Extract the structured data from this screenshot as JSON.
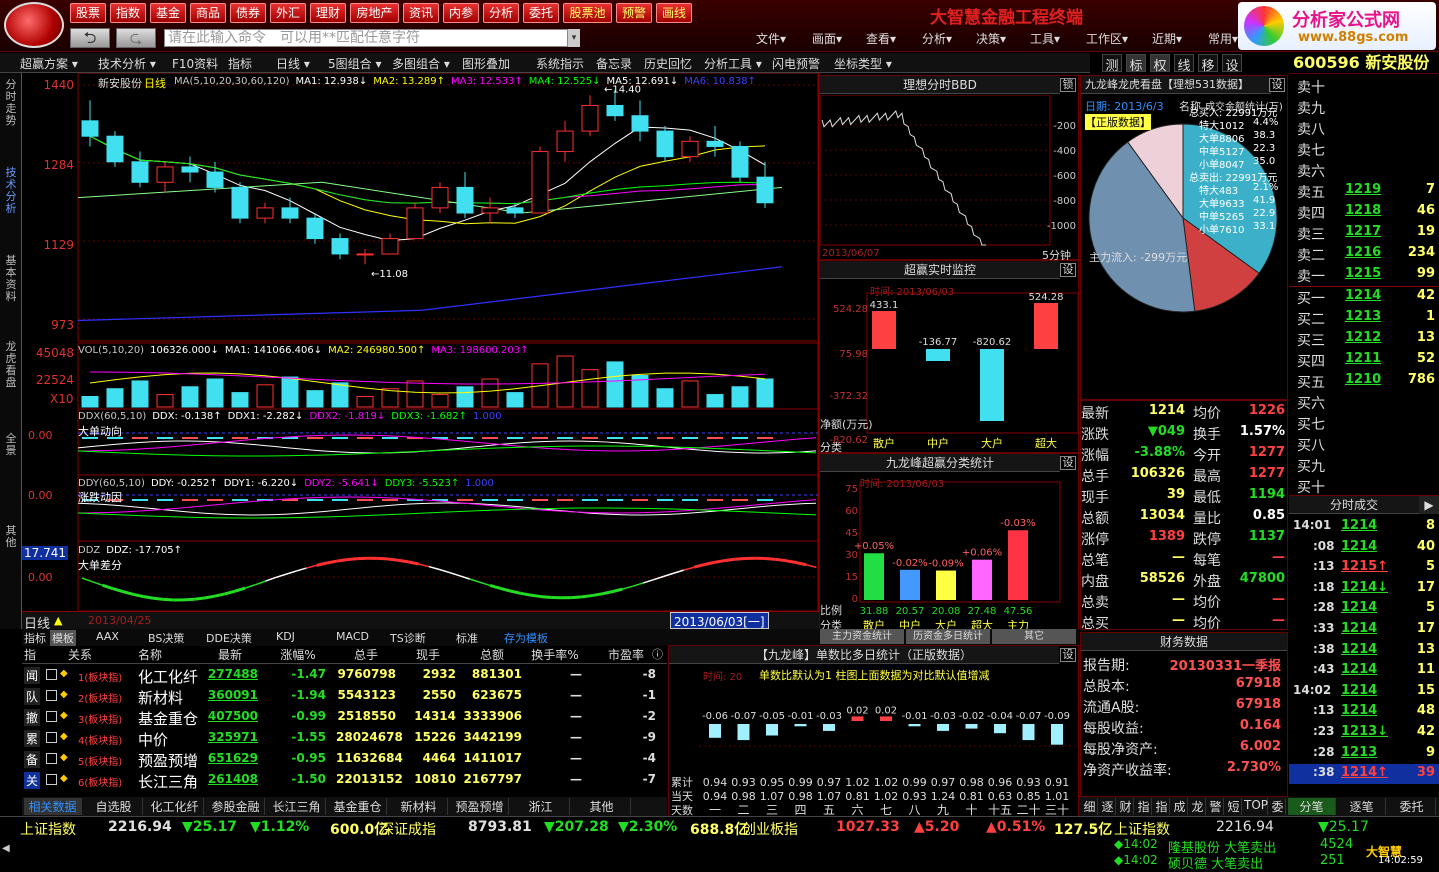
{
  "app": {
    "title": "大智慧金融工程终端",
    "brand_line1": "分析家公式网",
    "brand_line2": "www.88gs.com"
  },
  "top_menu": [
    "股票",
    "指数",
    "基金",
    "商品",
    "债券",
    "外汇",
    "理财",
    "房地产",
    "资讯",
    "内参",
    "分析",
    "委托",
    "股票池",
    "预警",
    "画线"
  ],
  "command_placeholder": "请在此输入命令　可以用**匹配任意字符",
  "right_menu": [
    "文件▾",
    "画面▾",
    "查看▾",
    "分析▾",
    "决策▾",
    "工具▾",
    "工作区▾",
    "近期▾",
    "常用▾"
  ],
  "toolbar": [
    "超赢方案 ▾",
    "技术分析 ▾",
    "F10资料",
    "指标",
    "日线 ▾",
    "5图组合 ▾",
    "多图组合 ▾",
    "图形叠加",
    "系统指示",
    "备忘录",
    "历史回忆",
    "分析工具 ▾",
    "闪电预警",
    "坐标类型 ▾"
  ],
  "toolbar_right": [
    "测",
    "标",
    "权",
    "线",
    "移",
    "设"
  ],
  "stock_header": "600596 新安股份",
  "left_tabs": [
    "分时走势",
    "技术分析",
    "基本资料",
    "龙虎看盘",
    "全景",
    "其他"
  ],
  "kline": {
    "name": "新安股份",
    "period": "日线",
    "ma_legend": [
      {
        "t": "MA(5,10,20,30,60,120)",
        "c": "#c8c8c8"
      },
      {
        "t": "MA1: 12.938↓",
        "c": "#ffffff"
      },
      {
        "t": "MA2: 13.289↑",
        "c": "#ffff00"
      },
      {
        "t": "MA3: 12.533↑",
        "c": "#ff00ff"
      },
      {
        "t": "MA4: 12.525↓",
        "c": "#00ff00"
      },
      {
        "t": "MA5: 12.691↓",
        "c": "#ffffff"
      },
      {
        "t": "MA6: 10.838↑",
        "c": "#4040ff"
      }
    ],
    "y_labels": [
      "1440",
      "1284",
      "1129",
      "973"
    ],
    "high_note": "←14.40",
    "low_note": "←11.08",
    "candles": [
      [
        13.8,
        14.2,
        13.3,
        13.5
      ],
      [
        13.5,
        13.6,
        12.9,
        13.0
      ],
      [
        13.0,
        13.2,
        12.5,
        12.6
      ],
      [
        12.6,
        13.0,
        12.4,
        12.9
      ],
      [
        12.9,
        13.1,
        12.6,
        12.8
      ],
      [
        12.8,
        13.0,
        12.4,
        12.5
      ],
      [
        12.5,
        12.6,
        11.8,
        11.9
      ],
      [
        11.9,
        12.2,
        11.8,
        12.1
      ],
      [
        12.1,
        12.3,
        11.8,
        11.9
      ],
      [
        11.9,
        12.0,
        11.4,
        11.5
      ],
      [
        11.5,
        11.6,
        11.1,
        11.2
      ],
      [
        11.2,
        11.3,
        11.0,
        11.2
      ],
      [
        11.2,
        11.6,
        11.2,
        11.5
      ],
      [
        11.5,
        12.2,
        11.5,
        12.1
      ],
      [
        12.1,
        12.6,
        12.0,
        12.5
      ],
      [
        12.5,
        12.8,
        11.9,
        12.0
      ],
      [
        12.0,
        12.3,
        11.8,
        12.1
      ],
      [
        12.1,
        12.2,
        11.9,
        12.0
      ],
      [
        12.0,
        13.3,
        12.0,
        13.2
      ],
      [
        13.2,
        13.8,
        13.0,
        13.6
      ],
      [
        13.6,
        14.3,
        13.5,
        14.1
      ],
      [
        14.1,
        14.4,
        13.8,
        13.9
      ],
      [
        13.9,
        14.2,
        13.4,
        13.6
      ],
      [
        13.6,
        13.7,
        13.0,
        13.1
      ],
      [
        13.1,
        13.5,
        13.0,
        13.4
      ],
      [
        13.4,
        13.7,
        13.1,
        13.3
      ],
      [
        13.3,
        13.4,
        12.6,
        12.7
      ],
      [
        12.7,
        13.0,
        12.1,
        12.2
      ]
    ],
    "vol_legend": [
      {
        "t": "VOL(5,10,20)",
        "c": "#c8c8c8"
      },
      {
        "t": "106326.000↓",
        "c": "#ffffff"
      },
      {
        "t": "MA1: 141066.406↓",
        "c": "#ffffff"
      },
      {
        "t": "MA2: 246980.500↑",
        "c": "#ffff00"
      },
      {
        "t": "MA3: 198600.203↑",
        "c": "#ff00ff"
      }
    ],
    "vol_y": [
      "45048",
      "22524",
      "X10"
    ],
    "ddx_legend": [
      {
        "t": "DDX(60,5,10)",
        "c": "#c8c8c8"
      },
      {
        "t": "DDX: -0.138↑",
        "c": "#ffffff"
      },
      {
        "t": "DDX1: -2.282↓",
        "c": "#ffffff"
      },
      {
        "t": "DDX2: -1.819↓",
        "c": "#ff00ff"
      },
      {
        "t": "DDX3: -1.682↑",
        "c": "#00ff00"
      },
      {
        "t": "1.000",
        "c": "#4040ff"
      }
    ],
    "ddx_sub": "大单动向",
    "ddy_legend": [
      {
        "t": "DDY(60,5,10)",
        "c": "#c8c8c8"
      },
      {
        "t": "DDY: -0.252↑",
        "c": "#ffffff"
      },
      {
        "t": "DDY1: -6.220↓",
        "c": "#ffffff"
      },
      {
        "t": "DDY2: -5.641↓",
        "c": "#ff00ff"
      },
      {
        "t": "DDY3: -5.523↑",
        "c": "#00ff00"
      },
      {
        "t": "1.000",
        "c": "#4040ff"
      }
    ],
    "ddy_sub": "涨跌动因",
    "ddz_value": "17.741",
    "ddz_legend": [
      {
        "t": "DDZ",
        "c": "#c8c8c8"
      },
      {
        "t": "DDZ: -17.705↑",
        "c": "#ffffff"
      }
    ],
    "ddz_sub": "大单差分",
    "zero": "0.00",
    "axis_start": "日线",
    "axis_date_left": "2013/04/25",
    "axis_date_right": "2013/06/03[一]"
  },
  "bbd": {
    "title": "理想分时BBD",
    "side": "锁",
    "y": [
      "-200",
      "-400",
      "-600",
      "-800",
      "-1000"
    ],
    "date": "2013/06/07",
    "period": "5分钟"
  },
  "monitor": {
    "title": "超赢实时监控",
    "set": "设",
    "time": "时间: 2013/06/03",
    "y": [
      "524.28",
      "75.98",
      "-372.32",
      "-820.62"
    ],
    "ylabel": "净额(万元)",
    "xcat": "分类",
    "cats": [
      "散户",
      "中户",
      "大户",
      "超大"
    ],
    "values": [
      433.1,
      -136.77,
      -820.62,
      524.28
    ],
    "labels": [
      "433.1",
      "-136.77",
      "-820.62",
      "524.28"
    ]
  },
  "classify": {
    "title": "九龙峰超赢分类统计",
    "set": "设",
    "time": "时间: 2013/06/03",
    "y": [
      "75",
      "60",
      "45",
      "30",
      "15",
      "0"
    ],
    "row1": "比例",
    "row2": "分类",
    "cats": [
      "散户",
      "中户",
      "大户",
      "超大",
      "主力"
    ],
    "values": [
      31.88,
      20.57,
      20.08,
      27.48,
      47.56
    ],
    "pcts": [
      "+0.05%",
      "-0.02%",
      "-0.09%",
      "+0.06%",
      "-0.03%"
    ],
    "colors": [
      "#22dd44",
      "#4499ff",
      "#ffff44",
      "#ff66ff",
      "#ff3344"
    ]
  },
  "dragon": {
    "title": "九龙峰龙虎看盘【理想531数据】",
    "set": "设",
    "date": "日期: 2013/6/3",
    "name": "名称",
    "vol": "成交金额统计(万)",
    "tag": "【正版数据】",
    "rows": [
      [
        "总买入: 22991万元",
        ""
      ],
      [
        "特大1012",
        "4.4%"
      ],
      [
        "大单8806",
        "38.3"
      ],
      [
        "中单5127",
        "22.3"
      ],
      [
        "小单8047",
        "35.0"
      ],
      [
        "总卖出: 22991万元",
        ""
      ],
      [
        "特大483",
        "2.1%"
      ],
      [
        "大单9633",
        "41.9"
      ],
      [
        "中单5265",
        "22.9"
      ],
      [
        "小单7610",
        "33.1"
      ]
    ],
    "flow": "主力流入: -299万元",
    "pie": [
      {
        "v": 0.35,
        "c": "#3bb0c8"
      },
      {
        "v": 0.13,
        "c": "#d04040"
      },
      {
        "v": 0.42,
        "c": "#7090b0"
      },
      {
        "v": 0.1,
        "c": "#eed0d8"
      }
    ]
  },
  "quote": [
    [
      "最新",
      "1214",
      "均价",
      "1226"
    ],
    [
      "涨跌",
      "▼049",
      "换手",
      "1.57%"
    ],
    [
      "涨幅",
      "-3.88%",
      "今开",
      "1277"
    ],
    [
      "总手",
      "106326",
      "最高",
      "1277"
    ],
    [
      "现手",
      "39",
      "最低",
      "1194"
    ],
    [
      "总额",
      "13034",
      "量比",
      "0.85"
    ],
    [
      "涨停",
      "1389",
      "跌停",
      "1137"
    ],
    [
      "总笔",
      "—",
      "每笔",
      "—"
    ],
    [
      "内盘",
      "58526",
      "外盘",
      "47800"
    ],
    [
      "总卖",
      "—",
      "均价",
      "—"
    ],
    [
      "总买",
      "—",
      "均价",
      "—"
    ]
  ],
  "book": {
    "sells": [
      [
        "卖十",
        "",
        ""
      ],
      [
        "卖九",
        "",
        ""
      ],
      [
        "卖八",
        "",
        ""
      ],
      [
        "卖七",
        "",
        ""
      ],
      [
        "卖六",
        "",
        ""
      ],
      [
        "卖五",
        "1219",
        "7"
      ],
      [
        "卖四",
        "1218",
        "46"
      ],
      [
        "卖三",
        "1217",
        "19"
      ],
      [
        "卖二",
        "1216",
        "234"
      ],
      [
        "卖一",
        "1215",
        "99"
      ]
    ],
    "buys": [
      [
        "买一",
        "1214",
        "42"
      ],
      [
        "买二",
        "1213",
        "1"
      ],
      [
        "买三",
        "1212",
        "13"
      ],
      [
        "买四",
        "1211",
        "52"
      ],
      [
        "买五",
        "1210",
        "786"
      ],
      [
        "买六",
        "",
        ""
      ],
      [
        "买七",
        "",
        ""
      ],
      [
        "买八",
        "",
        ""
      ],
      [
        "买九",
        "",
        ""
      ],
      [
        "买十",
        "",
        ""
      ]
    ]
  },
  "ticks": {
    "title": "分时成交",
    "rows": [
      [
        "14:01",
        "1214",
        "8"
      ],
      [
        ":08",
        "1214",
        "40"
      ],
      [
        ":13",
        "1215↑",
        "5"
      ],
      [
        ":18",
        "1214↓",
        "17"
      ],
      [
        ":28",
        "1214",
        "5"
      ],
      [
        ":33",
        "1214",
        "17"
      ],
      [
        ":38",
        "1214",
        "13"
      ],
      [
        ":43",
        "1214",
        "11"
      ],
      [
        "14:02",
        "1214",
        "15"
      ],
      [
        ":13",
        "1214",
        "48"
      ],
      [
        ":23",
        "1213↓",
        "42"
      ],
      [
        ":28",
        "1213",
        "9"
      ],
      [
        ":38",
        "1214↑",
        "39"
      ]
    ]
  },
  "finance": {
    "title": "财务数据",
    "rows": [
      [
        "报告期:",
        "20130331一季报"
      ],
      [
        "总股本:",
        "67918"
      ],
      [
        "流通A股:",
        "67918"
      ],
      [
        "每股收益:",
        "0.164"
      ],
      [
        "每股净资产:",
        "6.002"
      ],
      [
        "净资产收益率:",
        "2.730%"
      ]
    ]
  },
  "sub_tabs": [
    "指标",
    "模板",
    "AAX",
    "BS决策",
    "DDE决策",
    "KDJ",
    "MACD",
    "TS诊断",
    "标准",
    "存为模板"
  ],
  "right_sub_tabs": [
    "主力资金统计",
    "历资金多日统计",
    "其它"
  ],
  "table": {
    "headers": [
      "指",
      "关系",
      "名称",
      "最新",
      "涨幅%",
      "总手",
      "现手",
      "总额",
      "换手率%",
      "市盈率"
    ],
    "rows": [
      [
        "闻",
        "1(板块指)",
        "化工化纤",
        "277488",
        "-1.47",
        "9760798",
        "2932",
        "881301",
        "—",
        "-8"
      ],
      [
        "队",
        "2(板块指)",
        "新材料",
        "360091",
        "-1.94",
        "5543123",
        "2550",
        "623675",
        "—",
        "-1"
      ],
      [
        "撤",
        "3(板块指)",
        "基金重仓",
        "407500",
        "-0.99",
        "2518550",
        "14314",
        "3333906",
        "—",
        "-2"
      ],
      [
        "累",
        "4(板块指)",
        "中价",
        "325971",
        "-1.55",
        "28024678",
        "15226",
        "3442199",
        "—",
        "-9"
      ],
      [
        "备",
        "5(板块指)",
        "预盈预增",
        "651629",
        "-0.95",
        "11632684",
        "4464",
        "1411017",
        "—",
        "-4"
      ],
      [
        "关",
        "6(板块指)",
        "长江三角",
        "261408",
        "-1.50",
        "22013152",
        "10810",
        "2167797",
        "—",
        "-7"
      ]
    ]
  },
  "multiday": {
    "title": "【九龙峰】单数比多日统计（正版数据）",
    "set": "设",
    "time": "时间: 20",
    "note": "单数比默认为1 柱图上面数据为对比默认值增减",
    "row_labels": [
      "累计",
      "当天",
      "天数"
    ],
    "days": [
      "一",
      "二",
      "三",
      "四",
      "五",
      "六",
      "七",
      "八",
      "九",
      "十",
      "十五",
      "二十",
      "三十"
    ],
    "diffs": [
      "-0.06",
      "-0.07",
      "-0.05",
      "-0.01",
      "-0.03",
      "0.02",
      "0.02",
      "-0.01",
      "-0.03",
      "-0.02",
      "-0.04",
      "-0.07",
      "-0.09"
    ],
    "cum": [
      "0.94",
      "0.93",
      "0.95",
      "0.99",
      "0.97",
      "1.02",
      "1.02",
      "0.99",
      "0.97",
      "0.98",
      "0.96",
      "0.93",
      "0.91"
    ],
    "today": [
      "0.94",
      "0.98",
      "1.07",
      "0.98",
      "1.07",
      "0.81",
      "1.02",
      "0.93",
      "1.24",
      "0.81",
      "0.63",
      "0.85",
      "1.01"
    ]
  },
  "bottom_tabs": [
    "相关数据",
    "自选股",
    "化工化纤",
    "参股金融",
    "长江三角",
    "基金重仓",
    "新材料",
    "预盈预增",
    "浙江",
    "其他"
  ],
  "right_bottom_tabs": [
    "细",
    "逐",
    "财",
    "指",
    "指",
    "成",
    "龙",
    "警",
    "短",
    "TOP",
    "委",
    "分笔",
    "逐笔",
    "委托"
  ],
  "status": {
    "row1": [
      {
        "t": "上证指数",
        "c": "#ffff66"
      },
      {
        "t": "2216.94",
        "c": "#e0e0e0"
      },
      {
        "t": "▼25.17",
        "c": "#22dd22"
      },
      {
        "t": "▼1.12%",
        "c": "#22dd22"
      },
      {
        "t": "600.0亿",
        "c": "#ffff66"
      },
      {
        "t": "深证成指",
        "c": "#ffff66"
      },
      {
        "t": "8793.81",
        "c": "#e0e0e0"
      },
      {
        "t": "▼207.28",
        "c": "#22dd22"
      },
      {
        "t": "▼2.30%",
        "c": "#22dd22"
      },
      {
        "t": "688.8亿",
        "c": "#ffff66"
      },
      {
        "t": "创业板指",
        "c": "#ffff66"
      },
      {
        "t": "1027.33",
        "c": "#ff4040"
      },
      {
        "t": "▲5.20",
        "c": "#ff4040"
      },
      {
        "t": "▲0.51%",
        "c": "#ff4040"
      },
      {
        "t": "127.5亿",
        "c": "#ffff66"
      }
    ],
    "right_index": [
      {
        "t": "上证指数",
        "c": "#ffff66"
      },
      {
        "t": "2216.94",
        "c": "#e0e0e0"
      },
      {
        "t": "▼25.17",
        "c": "#22dd22"
      }
    ],
    "news": [
      [
        "◆14:02",
        "隆基股份 大笔卖出",
        "4524"
      ],
      [
        "◆14:02",
        "硕贝德 大笔卖出",
        "251"
      ]
    ],
    "clock": "14:02:59",
    "logo": "大智慧"
  }
}
